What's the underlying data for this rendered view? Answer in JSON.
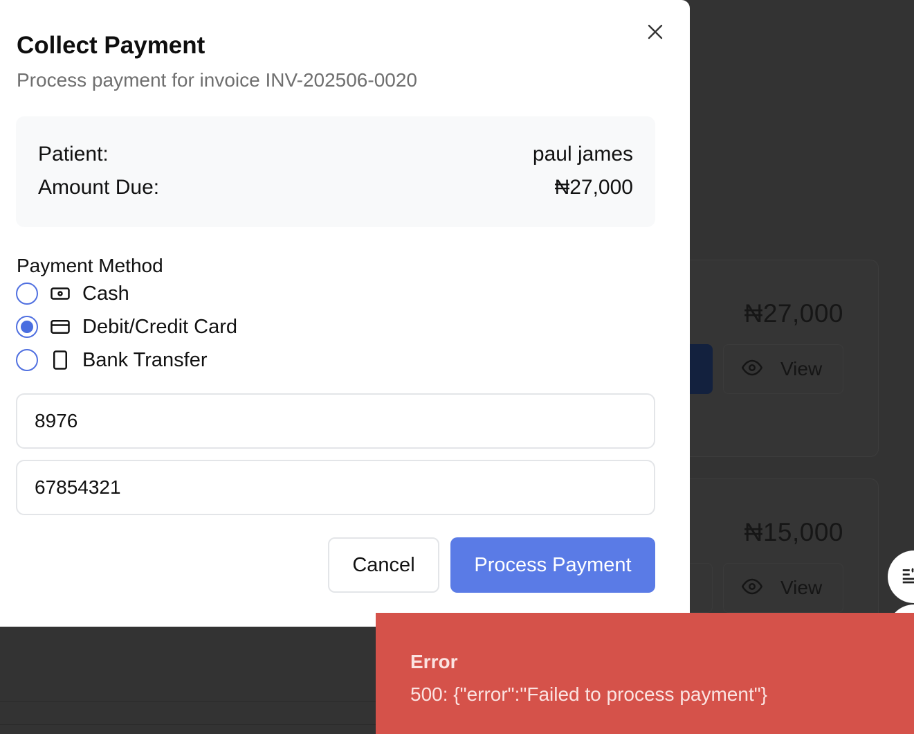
{
  "modal": {
    "title": "Collect Payment",
    "subtitle": "Process payment for invoice INV-202506-0020",
    "summary": {
      "patient_label": "Patient:",
      "patient_value": "paul james",
      "amount_label": "Amount Due:",
      "amount_value": "₦27,000"
    },
    "payment_method_label": "Payment Method",
    "options": [
      {
        "label": "Cash",
        "icon": "banknote-icon",
        "selected": false
      },
      {
        "label": "Debit/Credit Card",
        "icon": "credit-card-icon",
        "selected": true
      },
      {
        "label": "Bank Transfer",
        "icon": "smartphone-icon",
        "selected": false
      }
    ],
    "fields": {
      "field1_value": "8976",
      "field2_value": "67854321"
    },
    "cancel_label": "Cancel",
    "submit_label": "Process Payment",
    "accent_color": "#5a7be6"
  },
  "background": {
    "card1_amount": "₦27,000",
    "card2_amount": "₦15,000",
    "view_label": "View"
  },
  "toast": {
    "title": "Error",
    "message": "500: {\"error\":\"Failed to process payment\"}",
    "color": "#d5524a"
  }
}
